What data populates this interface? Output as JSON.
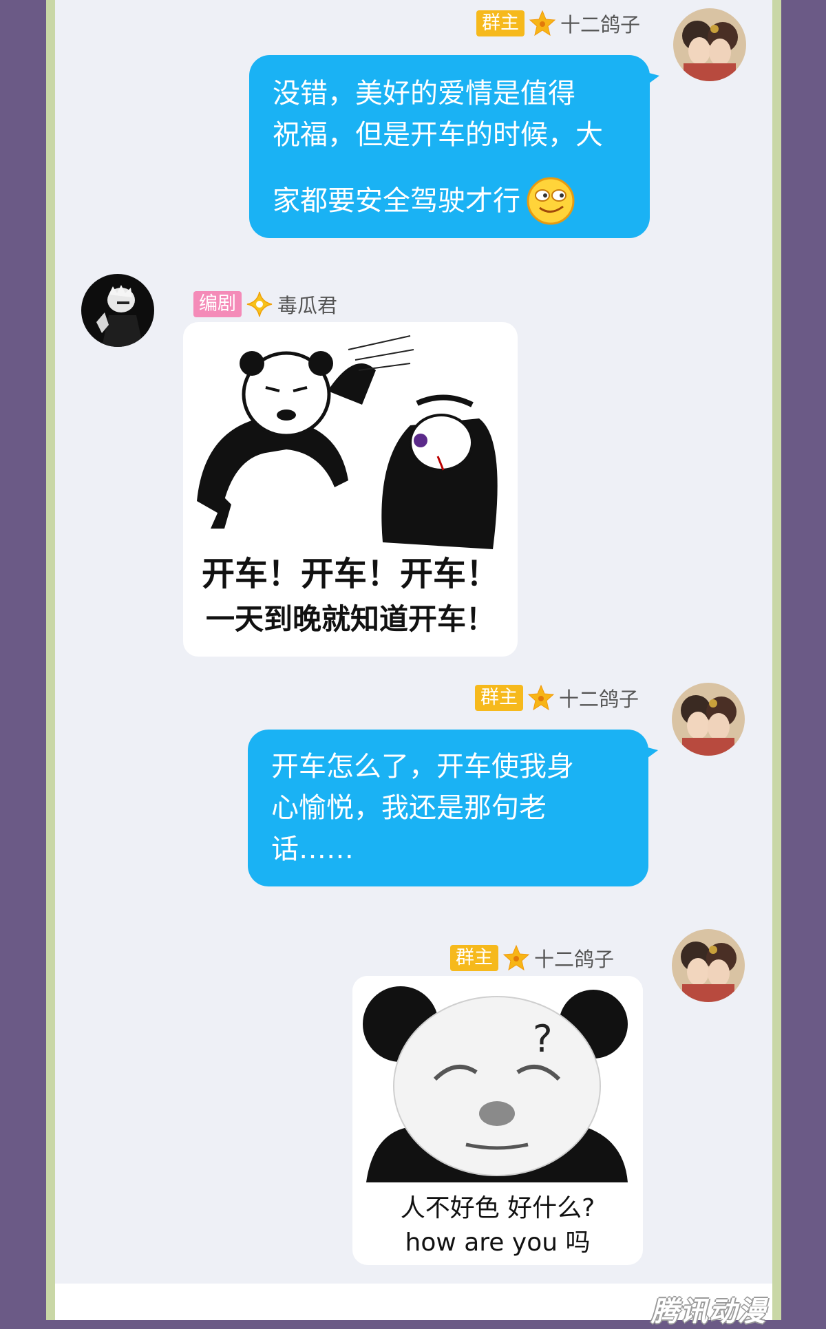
{
  "brand": {
    "watermark": "腾讯动漫"
  },
  "colors": {
    "bubble": "#1ab2f4",
    "owner_badge": "#f6b91c",
    "writer_badge": "#f48bb8",
    "panel": "#eef0f6"
  },
  "messages": [
    {
      "sender": {
        "badge": "群主",
        "name": "十二鸽子",
        "icon": "star-icon"
      },
      "lines": [
        "没错，美好的爱情是值得",
        "祝福，但是开车的时候，大",
        "家都要安全驾驶才行"
      ],
      "emoji": "smirk-face-icon"
    },
    {
      "sender": {
        "badge": "编剧",
        "name": "毒瓜君",
        "icon": "diamond-star-icon"
      },
      "sticker": {
        "caption_line1": "开车！开车！开车！",
        "caption_line2": "一天到晚就知道开车！"
      }
    },
    {
      "sender": {
        "badge": "群主",
        "name": "十二鸽子",
        "icon": "star-icon"
      },
      "lines": [
        "开车怎么了，开车使我身",
        "心愉悦，我还是那句老",
        "话……"
      ]
    },
    {
      "sender": {
        "badge": "群主",
        "name": "十二鸽子",
        "icon": "star-icon"
      },
      "sticker": {
        "question_mark": "?",
        "caption_line1": "人不好色 好什么?",
        "caption_line2": "how are you 吗"
      }
    }
  ]
}
